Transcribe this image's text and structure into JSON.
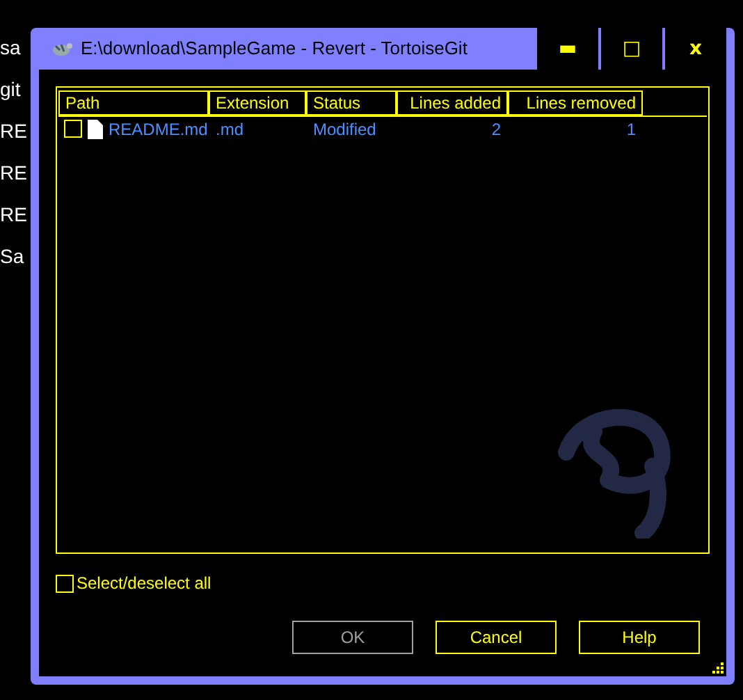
{
  "background_rows": [
    {
      "column_1": "sa"
    },
    {
      "column_1": "git"
    },
    {
      "column_1": "RE"
    },
    {
      "column_1": "RE"
    },
    {
      "column_1": "RE"
    },
    {
      "column_1": "Sa"
    }
  ],
  "window": {
    "title": "E:\\download\\SampleGame - Revert - TortoiseGit",
    "controls": [
      "▬",
      "□",
      "x"
    ]
  },
  "table": {
    "columns": [
      "Path",
      "Extension",
      "Status",
      "Lines added",
      "Lines removed"
    ],
    "rows": [
      {
        "checked": false,
        "path": "README.md",
        "extension": ".md",
        "status": "Modified",
        "lines_added": "2",
        "lines_removed": "1"
      }
    ]
  },
  "select_all": {
    "label": "Select/deselect all",
    "checked": false
  },
  "buttons": [
    {
      "label": "OK",
      "disabled": true
    },
    {
      "label": "Cancel",
      "disabled": false
    },
    {
      "label": "Help",
      "disabled": false
    }
  ]
}
